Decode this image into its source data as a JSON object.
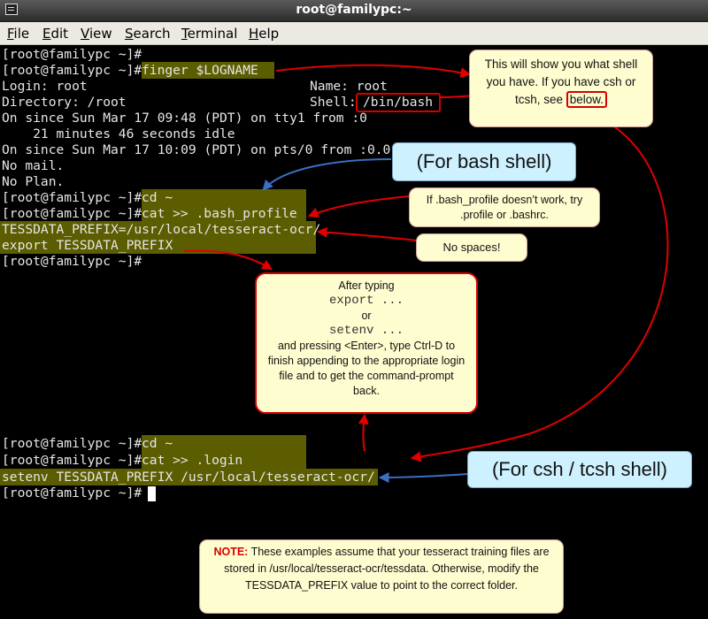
{
  "window": {
    "title": "root@familypc:~"
  },
  "menu": [
    {
      "accel": "F",
      "rest": "ile"
    },
    {
      "accel": "E",
      "rest": "dit"
    },
    {
      "accel": "V",
      "rest": "iew"
    },
    {
      "accel": "S",
      "rest": "earch"
    },
    {
      "accel": "T",
      "rest": "erminal"
    },
    {
      "accel": "H",
      "rest": "elp"
    }
  ],
  "terminal": {
    "prompt": "[root@familypc ~]#",
    "lines": {
      "login": "Login: root",
      "name": "Name: root",
      "directory": "Directory: /root",
      "shell_label": "Shell:",
      "shell_value": "/bin/bash",
      "since1": "On since Sun Mar 17 09:48 (PDT) on tty1 from :0",
      "idle": "    21 minutes 46 seconds idle",
      "since2": "On since Sun Mar 17 10:09 (PDT) on pts/0 from :0.0",
      "nomail": "No mail.",
      "noplan": "No Plan."
    },
    "commands": {
      "finger": "finger $LOGNAME",
      "cd": "cd ~",
      "cat_bash": "cat >> .bash_profile",
      "tess_assign": "TESSDATA_PREFIX=/usr/local/tesseract-ocr/",
      "export": "export TESSDATA_PREFIX",
      "cat_login": "cat >> .login",
      "setenv": "setenv TESSDATA_PREFIX /usr/local/tesseract-ocr/"
    }
  },
  "callouts": {
    "finger_note": {
      "text1": "This will show you what shell you have.  If you have csh or tcsh, see",
      "below": "below."
    },
    "bash": "(For bash shell)",
    "bash_profile": "If .bash_profile doesn’t work, try .profile or .bashrc.",
    "nospaces": "No spaces!",
    "typing": {
      "line1": "After typing",
      "code1": "export ...",
      "or": "or",
      "code2": "setenv ...",
      "line2": "and pressing <Enter>, type Ctrl-D to finish appending to the appropriate login file and to get the command-prompt back."
    },
    "csh": "(For csh / tcsh shell)",
    "note": {
      "label": "NOTE:",
      "text": "These examples assume that your tesseract training files are stored in /usr/local/tesseract-ocr/tessdata. Otherwise, modify the TESSDATA_PREFIX value to point to the correct folder."
    }
  },
  "colors": {
    "highlight": "#5c5d00",
    "arrow_red": "#e00000",
    "arrow_blue": "#3b6fc4"
  }
}
